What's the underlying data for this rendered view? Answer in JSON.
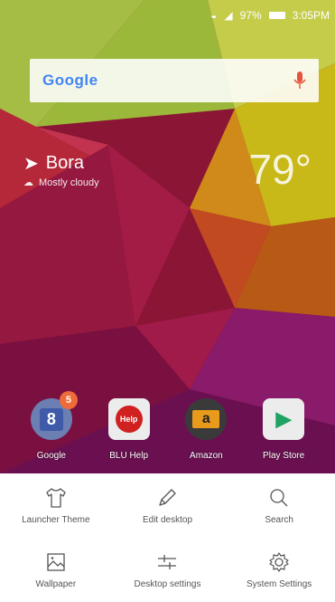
{
  "status": {
    "battery": "97%",
    "time": "3:05PM"
  },
  "search": {
    "logo": "Google"
  },
  "weather": {
    "city": "Bora",
    "condition": "Mostly cloudy",
    "temperature": "79°"
  },
  "dock": [
    {
      "label": "Google",
      "badge": "5",
      "glyph": "8"
    },
    {
      "label": "BLU Help",
      "glyph": "Help"
    },
    {
      "label": "Amazon",
      "glyph": "a"
    },
    {
      "label": "Play Store",
      "glyph": "▶"
    }
  ],
  "menu": [
    {
      "label": "Launcher Theme",
      "icon": "tshirt-icon"
    },
    {
      "label": "Edit desktop",
      "icon": "pencil-icon"
    },
    {
      "label": "Search",
      "icon": "search-icon"
    },
    {
      "label": "Wallpaper",
      "icon": "image-icon"
    },
    {
      "label": "Desktop settings",
      "icon": "sliders-icon"
    },
    {
      "label": "System Settings",
      "icon": "gear-icon"
    }
  ],
  "colors": {
    "menu_bg": "#ffffff",
    "badge": "#ef6c3a",
    "menu_text": "#555555"
  }
}
